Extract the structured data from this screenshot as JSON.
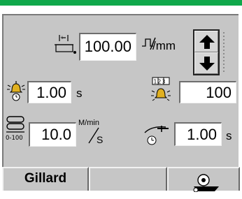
{
  "header": {
    "accent_color": "#0fa84b"
  },
  "length": {
    "icon": "cut-length-icon",
    "value": "100.00",
    "unit_icon": "pulse-per-mm-icon",
    "unit_suffix": "/mm",
    "spin_up": "arrow-up-icon",
    "spin_down": "arrow-down-icon"
  },
  "delay_time": {
    "icon": "alarm-bell-clock-icon",
    "value": "1.00",
    "unit": "s"
  },
  "counter": {
    "icon": "alarm-bell-counter-icon",
    "icon_text": "123",
    "value": "100"
  },
  "speed": {
    "icon": "speed-range-icon",
    "range_label": "0-100",
    "value": "10.0",
    "unit_top": "M/min",
    "unit_bottom": "S"
  },
  "knife_time": {
    "icon": "knife-clock-icon",
    "value": "1.00",
    "unit": "s"
  },
  "tabs": [
    {
      "label": "Gillard"
    },
    {
      "label": ""
    },
    {
      "label": "",
      "icon": "conveyor-gear-icon"
    }
  ]
}
